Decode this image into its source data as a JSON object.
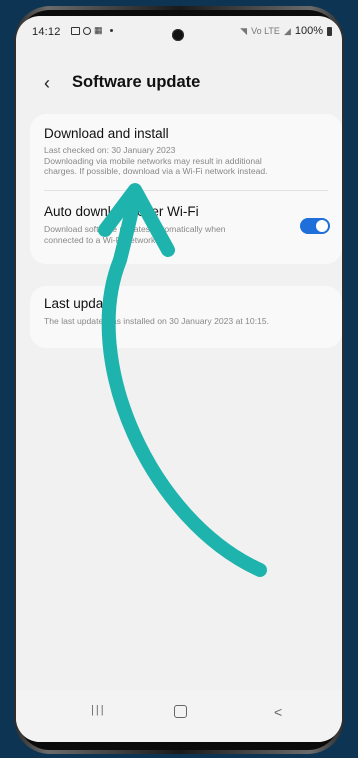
{
  "status_bar": {
    "time": "14:12",
    "grid_icon": "📶",
    "network_lte": "Vo LTE",
    "battery": "100%"
  },
  "header": {
    "title": "Software update"
  },
  "items": [
    {
      "title": "Download and install",
      "subtitle_1": "Last checked on: 30 January 2023",
      "subtitle_2": "Downloading via mobile networks may result in additional",
      "subtitle_3": "charges. If possible, download via a Wi-Fi network instead."
    },
    {
      "title": "Auto download over Wi-Fi",
      "subtitle_1": "Download software updates automatically when",
      "subtitle_2": "connected to a Wi-Fi network.",
      "toggle_on": true
    },
    {
      "title": "Last update",
      "subtitle_1": "The last update was installed on 30 January 2023 at 10:15."
    }
  ],
  "navbar": {
    "recent": "|||",
    "back": "<"
  },
  "colors": {
    "accent": "#1e6fd9",
    "arrow": "#1fb3ad",
    "background": "#0d3553"
  }
}
